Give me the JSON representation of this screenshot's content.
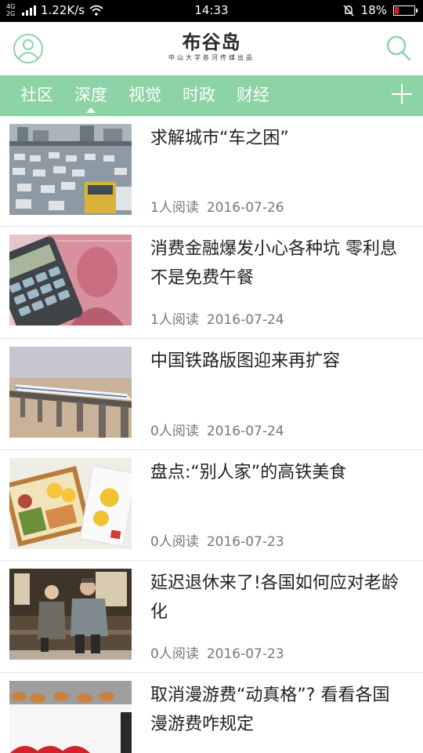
{
  "status_bar": {
    "network_type": "4G 2G",
    "speed": "1.22K/s",
    "time": "14:33",
    "battery": "18%",
    "battery_color": "#e02020",
    "icons": [
      "signal-icon",
      "wifi-icon",
      "mute-icon",
      "battery-icon"
    ]
  },
  "header": {
    "logo_title": "布谷岛",
    "logo_subtitle": "中山大学各河传媒出品",
    "left_icon": "user-icon",
    "right_icon": "search-icon"
  },
  "nav": {
    "tabs": [
      {
        "label": "社区",
        "active": false
      },
      {
        "label": "深度",
        "active": true
      },
      {
        "label": "视觉",
        "active": false
      },
      {
        "label": "时政",
        "active": false
      },
      {
        "label": "财经",
        "active": false
      }
    ],
    "add_icon": "plus-icon",
    "accent_color": "#8cd3a5"
  },
  "articles": [
    {
      "title": "求解城市“车之困”",
      "reads": "1人阅读",
      "date": "2016-07-26",
      "image": "traffic-jam-photo"
    },
    {
      "title": "消费金融爆发小心各种坑 零利息不是免费午餐",
      "reads": "1人阅读",
      "date": "2016-07-24",
      "image": "calculator-banknote-photo"
    },
    {
      "title": "中国铁路版图迎来再扩容",
      "reads": "0人阅读",
      "date": "2016-07-24",
      "image": "high-speed-train-photo"
    },
    {
      "title": "盘点:“别人家”的高铁美食",
      "reads": "0人阅读",
      "date": "2016-07-23",
      "image": "bento-box-photo"
    },
    {
      "title": "延迟退休来了!各国如何应对老龄化",
      "reads": "0人阅读",
      "date": "2016-07-23",
      "image": "elderly-couple-photo"
    },
    {
      "title": "取消漫游费“动真格”? 看看各国漫游费咋规定",
      "reads": "",
      "date": "",
      "image": "docomo-sign-photo"
    }
  ]
}
